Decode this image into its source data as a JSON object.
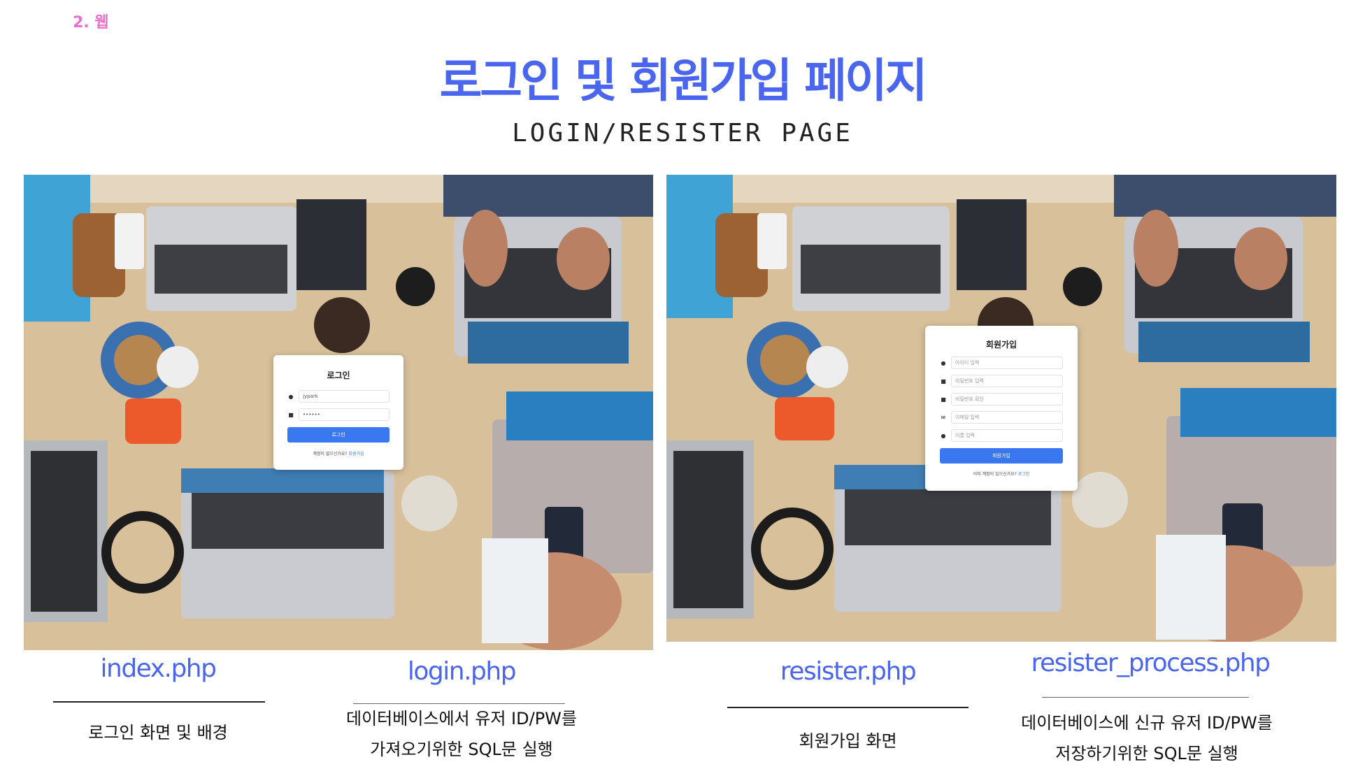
{
  "header": {
    "section_tag": "2. 웹",
    "title": "로그인 및 회원가입 페이지",
    "subtitle": "LOGIN/RESISTER PAGE"
  },
  "login_card": {
    "title": "로그인",
    "username_value": "jypark",
    "password_value": "••••••",
    "submit_label": "로그인",
    "footer_text": "계정이 없으신가요?",
    "footer_link": "회원가입"
  },
  "register_card": {
    "title": "회원가입",
    "fields": [
      {
        "icon": "user-icon",
        "placeholder": "아이디 입력"
      },
      {
        "icon": "lock-icon",
        "placeholder": "비밀번호 입력"
      },
      {
        "icon": "lock-icon",
        "placeholder": "비밀번호 확인"
      },
      {
        "icon": "mail-icon",
        "placeholder": "이메일 입력"
      },
      {
        "icon": "user-icon",
        "placeholder": "이름 입력"
      }
    ],
    "submit_label": "회원가입",
    "footer_text": "이미 계정이 있으신가요?",
    "footer_link": "로그인"
  },
  "captions": {
    "index": {
      "file": "index.php",
      "lines": [
        "로그인 화면 및 배경"
      ]
    },
    "login": {
      "file": "login.php",
      "lines": [
        "데이터베이스에서 유저 ID/PW를",
        "가져오기위한 SQL문 실행"
      ]
    },
    "resister": {
      "file": "resister.php",
      "lines": [
        "회원가입 화면"
      ]
    },
    "resister_process": {
      "file": "resister_process.php",
      "lines": [
        "데이터베이스에 신규 유저 ID/PW를",
        "저장하기위한 SQL문 실행"
      ]
    }
  },
  "colors": {
    "accent": "#4b66ee",
    "tag": "#ec6fd0",
    "button": "#3a78f2"
  }
}
